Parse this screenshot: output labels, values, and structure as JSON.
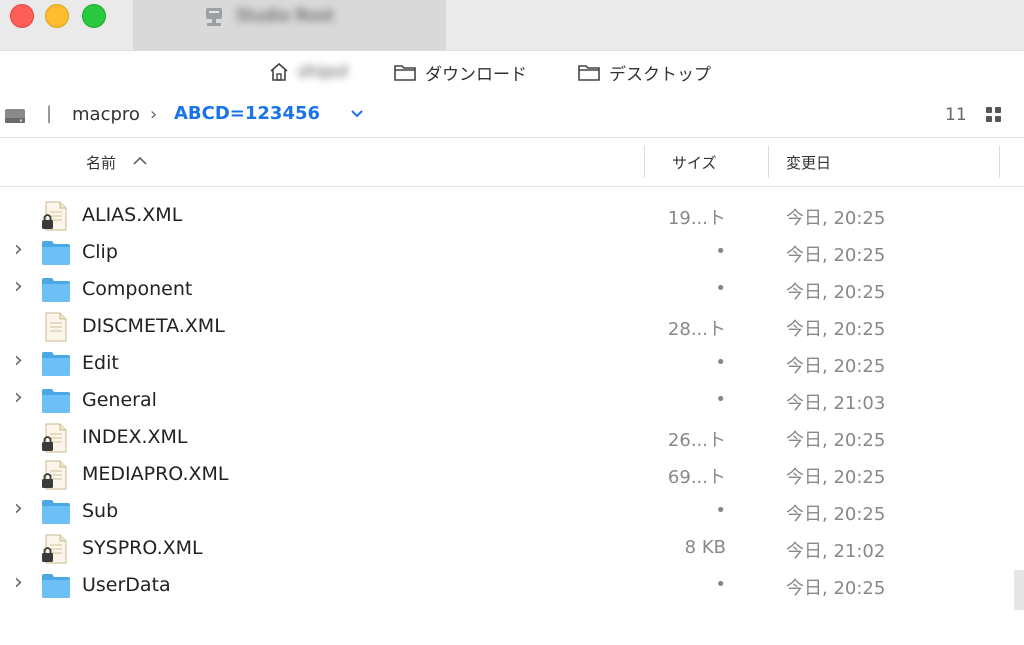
{
  "window": {
    "active_tab_title": "Studio Root"
  },
  "favorites": {
    "home_label": "shipol",
    "downloads_label": "ダウンロード",
    "desktop_label": "デスクトップ"
  },
  "path": {
    "parent": "macpro",
    "current": "ABCD=123456",
    "item_count": "11"
  },
  "columns": {
    "name": "名前",
    "size": "サイズ",
    "modified": "変更日"
  },
  "files": [
    {
      "name": "ALIAS.XML",
      "kind": "xml-locked",
      "size": "19...ト",
      "modified": "今日, 20:25",
      "expandable": false
    },
    {
      "name": "Clip",
      "kind": "folder",
      "size": "•",
      "modified": "今日, 20:25",
      "expandable": true
    },
    {
      "name": "Component",
      "kind": "folder",
      "size": "•",
      "modified": "今日, 20:25",
      "expandable": true
    },
    {
      "name": "DISCMETA.XML",
      "kind": "xml",
      "size": "28...ト",
      "modified": "今日, 20:25",
      "expandable": false
    },
    {
      "name": "Edit",
      "kind": "folder",
      "size": "•",
      "modified": "今日, 20:25",
      "expandable": true
    },
    {
      "name": "General",
      "kind": "folder",
      "size": "•",
      "modified": "今日, 21:03",
      "expandable": true
    },
    {
      "name": "INDEX.XML",
      "kind": "xml-locked",
      "size": "26...ト",
      "modified": "今日, 20:25",
      "expandable": false
    },
    {
      "name": "MEDIAPRO.XML",
      "kind": "xml-locked",
      "size": "69...ト",
      "modified": "今日, 20:25",
      "expandable": false
    },
    {
      "name": "Sub",
      "kind": "folder",
      "size": "•",
      "modified": "今日, 20:25",
      "expandable": true
    },
    {
      "name": "SYSPRO.XML",
      "kind": "xml-locked",
      "size": "8 KB",
      "modified": "今日, 21:02",
      "expandable": false
    },
    {
      "name": "UserData",
      "kind": "folder",
      "size": "•",
      "modified": "今日, 20:25",
      "expandable": true
    }
  ],
  "colors": {
    "accent": "#1a73e8",
    "folder": "#5bb8f0"
  }
}
